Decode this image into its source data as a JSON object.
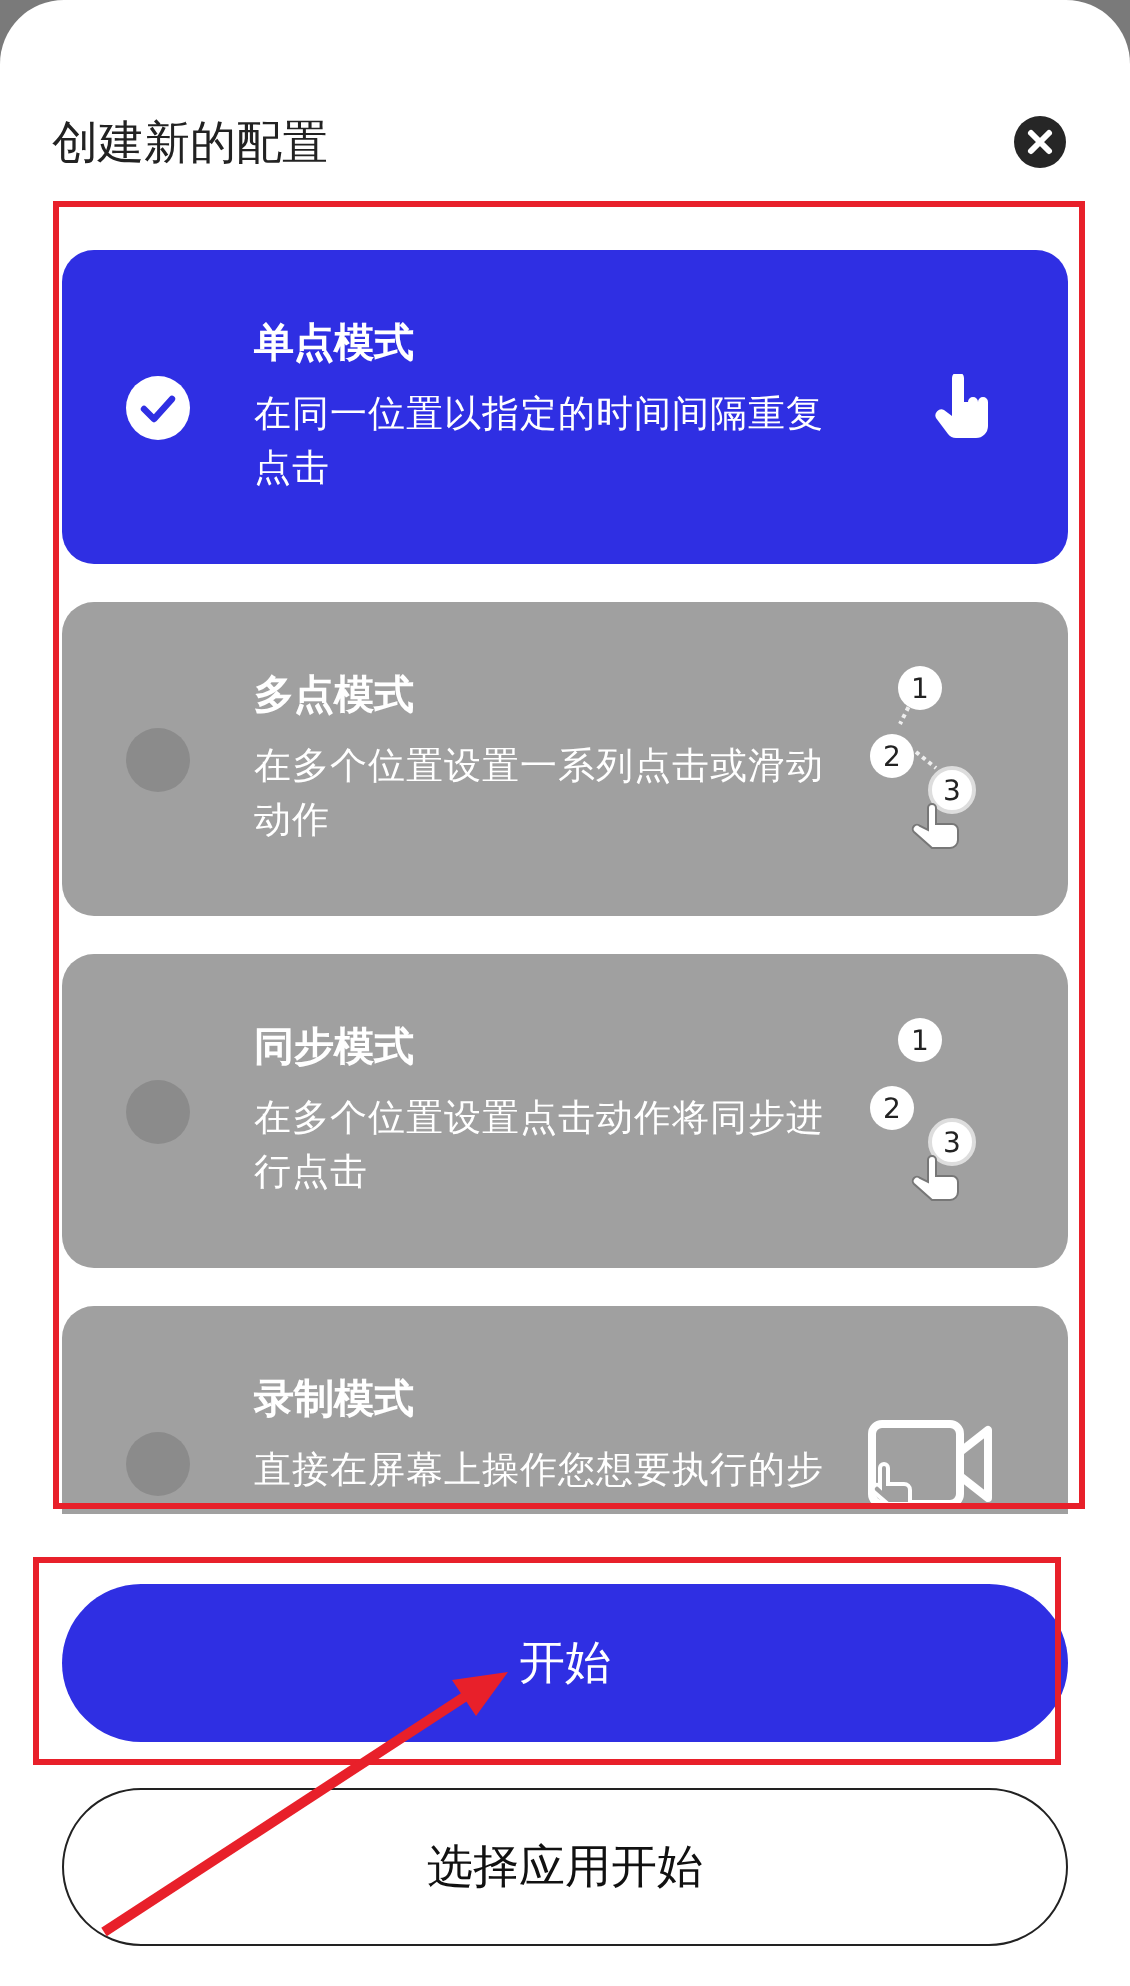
{
  "title": "创建新的配置",
  "modes": [
    {
      "kind": "single",
      "title": "单点模式",
      "description": "在同一位置以指定的时间间隔重复点击",
      "selected": true
    },
    {
      "kind": "multi",
      "title": "多点模式",
      "description": "在多个位置设置一系列点击或滑动动作",
      "selected": false,
      "markers": [
        "1",
        "2",
        "3"
      ]
    },
    {
      "kind": "sync",
      "title": "同步模式",
      "description": "在多个位置设置点击动作将同步进行点击",
      "selected": false,
      "markers": [
        "1",
        "2",
        "3"
      ]
    },
    {
      "kind": "record",
      "title": "录制模式",
      "description": "直接在屏幕上操作您想要执行的步",
      "selected": false
    }
  ],
  "buttons": [
    {
      "kind": "primary",
      "label": "开始"
    },
    {
      "kind": "outline",
      "label": "选择应用开始"
    }
  ]
}
